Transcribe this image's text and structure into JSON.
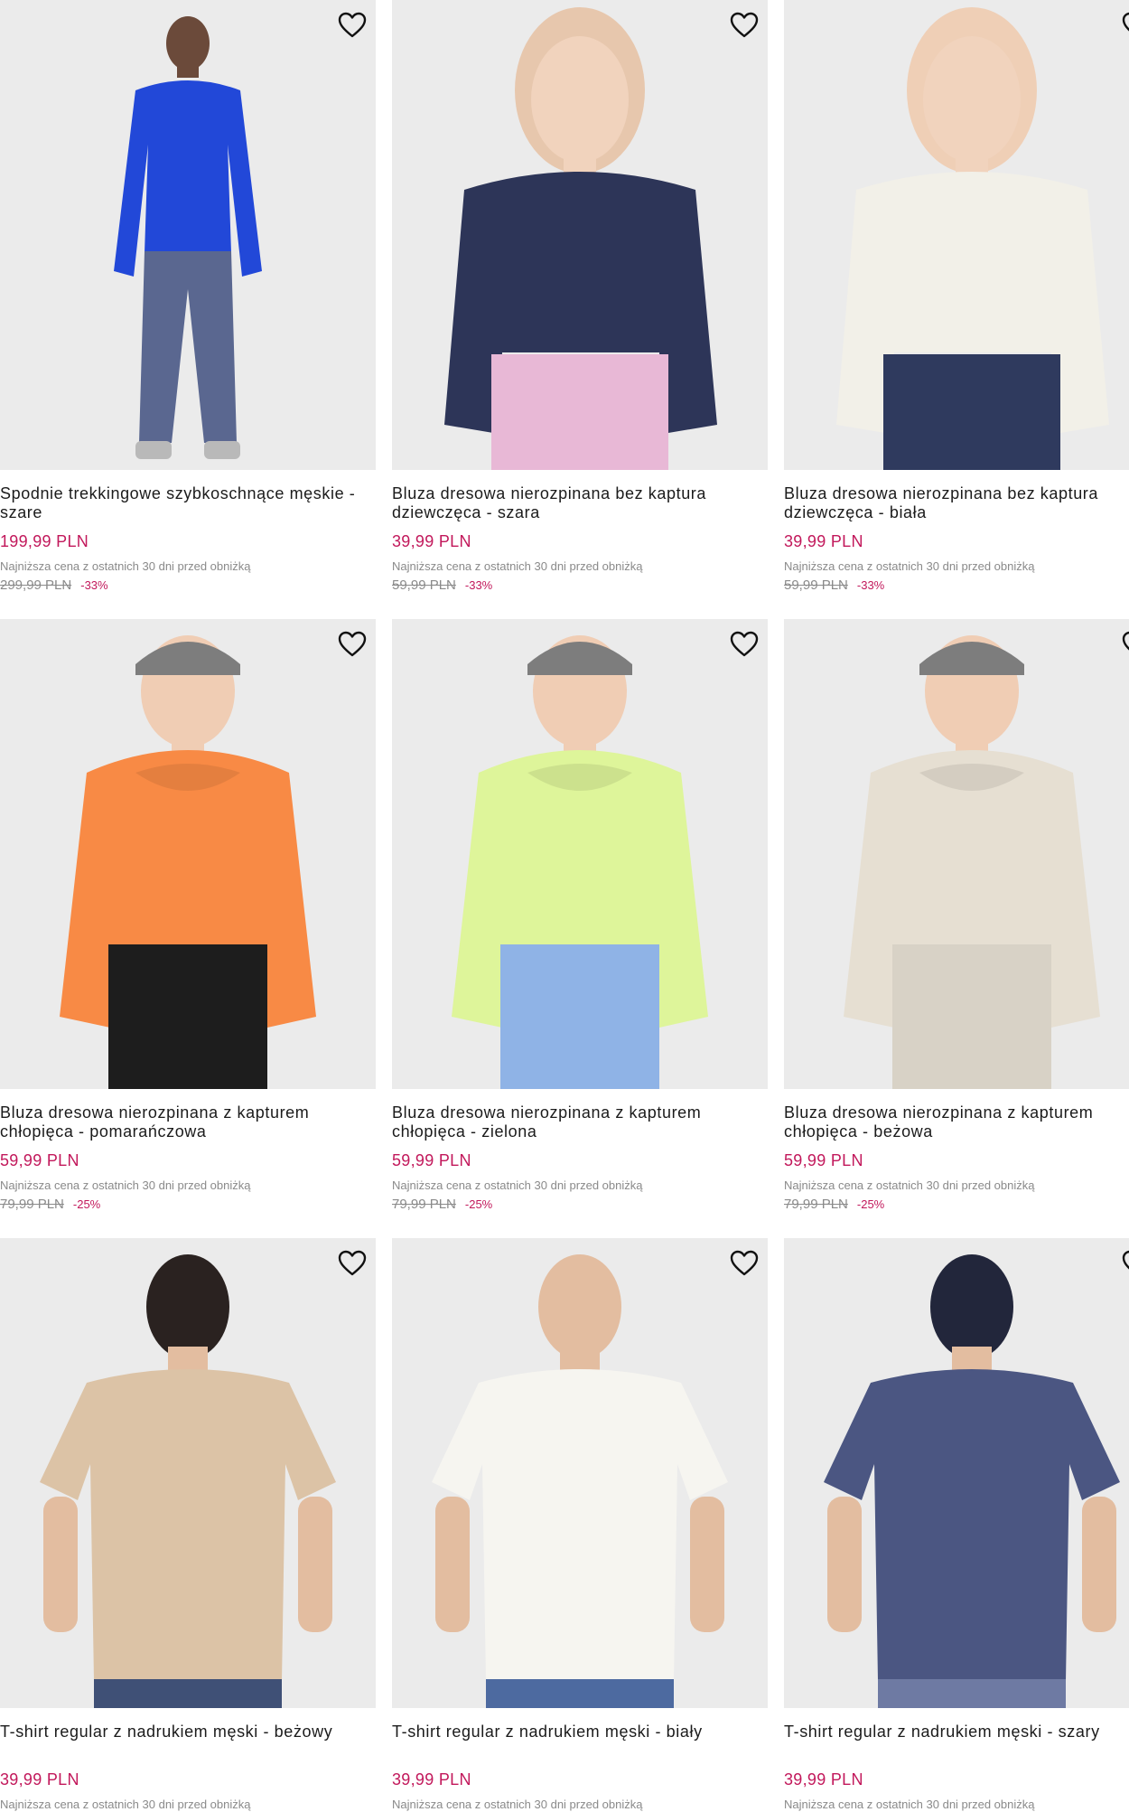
{
  "colors": {
    "price": "#c2185b",
    "muted": "#8a8a8a",
    "image_bg": "#ebebeb"
  },
  "products": [
    {
      "title": "Spodnie trekkingowe szybkoschnące męskie - szare",
      "price": "199,99 PLN",
      "note": "Najniższa cena z ostatnich 30 dni przed obniżką",
      "old_price": "299,99 PLN",
      "discount": "-33%",
      "icon": "heart-icon",
      "colors": {
        "top": "#2248d8",
        "bottom": "#5a6790",
        "head": "#4a3226"
      }
    },
    {
      "title": "Bluza dresowa nierozpinana bez kaptura dziewczęca - szara",
      "price": "39,99 PLN",
      "note": "Najniższa cena z ostatnich 30 dni przed obniżką",
      "old_price": "59,99 PLN",
      "discount": "-33%",
      "icon": "heart-icon",
      "colors": {
        "top": "#2d3558",
        "bottom": "#e8b8d6",
        "head": "#e7c7ad"
      }
    },
    {
      "title": "Bluza dresowa nierozpinana bez kaptura dziewczęca - biała",
      "price": "39,99 PLN",
      "note": "Najniższa cena z ostatnich 30 dni przed obniżką",
      "old_price": "59,99 PLN",
      "discount": "-33%",
      "icon": "heart-icon",
      "colors": {
        "top": "#f2f0e8",
        "bottom": "#2f3a5e",
        "head": "#efcfb6"
      }
    },
    {
      "title": "Bluza dresowa nierozpinana z kapturem chłopięca - pomarańczowa",
      "price": "59,99 PLN",
      "note": "Najniższa cena z ostatnich 30 dni przed obniżką",
      "old_price": "79,99 PLN",
      "discount": "-25%",
      "icon": "heart-icon",
      "colors": {
        "top": "#f88a45",
        "bottom": "#1d1d1d",
        "head": "#f0cdb4"
      }
    },
    {
      "title": "Bluza dresowa nierozpinana z kapturem chłopięca - zielona",
      "price": "59,99 PLN",
      "note": "Najniższa cena z ostatnich 30 dni przed obniżką",
      "old_price": "79,99 PLN",
      "discount": "-25%",
      "icon": "heart-icon",
      "colors": {
        "top": "#def59a",
        "bottom": "#8fb3e6",
        "head": "#f0cdb4"
      }
    },
    {
      "title": "Bluza dresowa nierozpinana z kapturem chłopięca - beżowa",
      "price": "59,99 PLN",
      "note": "Najniższa cena z ostatnich 30 dni przed obniżką",
      "old_price": "79,99 PLN",
      "discount": "-25%",
      "icon": "heart-icon",
      "colors": {
        "top": "#e6dfd2",
        "bottom": "#d8d2c6",
        "head": "#f0cdb4"
      }
    },
    {
      "title": "T-shirt regular z nadrukiem męski - beżowy",
      "price": "39,99 PLN",
      "note": "Najniższa cena z ostatnich 30 dni przed obniżką",
      "old_price": "",
      "discount": "",
      "icon": "heart-icon",
      "colors": {
        "top": "#dcc3a6",
        "bottom": "#3f5076",
        "head": "#2a2220"
      }
    },
    {
      "title": "T-shirt regular z nadrukiem męski - biały",
      "price": "39,99 PLN",
      "note": "Najniższa cena z ostatnich 30 dni przed obniżką",
      "old_price": "",
      "discount": "",
      "icon": "heart-icon",
      "colors": {
        "top": "#f6f5f0",
        "bottom": "#4d6aa0",
        "head": "#e3bda0"
      }
    },
    {
      "title": "T-shirt regular z nadrukiem męski - szary",
      "price": "39,99 PLN",
      "note": "Najniższa cena z ostatnich 30 dni przed obniżką",
      "old_price": "",
      "discount": "",
      "icon": "heart-icon",
      "colors": {
        "top": "#4b5682",
        "bottom": "#6e7aa3",
        "head": "#22263b"
      }
    }
  ]
}
